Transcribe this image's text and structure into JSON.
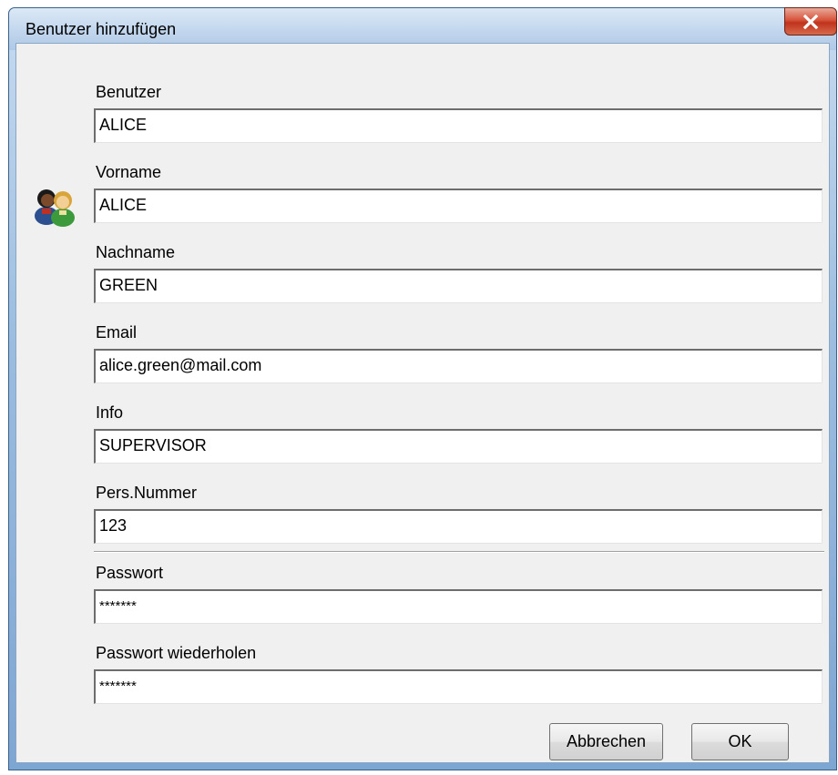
{
  "window": {
    "title": "Benutzer hinzufügen",
    "close_glyph": "X"
  },
  "fields": [
    {
      "label": "Benutzer",
      "value": "ALICE"
    },
    {
      "label": "Vorname",
      "value": "ALICE"
    },
    {
      "label": "Nachname",
      "value": "GREEN"
    },
    {
      "label": "Email",
      "value": "alice.green@mail.com"
    },
    {
      "label": "Info",
      "value": "SUPERVISOR"
    },
    {
      "label": "Pers.Nummer",
      "value": "123"
    },
    {
      "label": "Passwort",
      "value": "*******"
    },
    {
      "label": "Passwort wiederholen",
      "value": "*******"
    }
  ],
  "buttons": {
    "cancel": "Abbrechen",
    "ok": "OK"
  },
  "icons": {
    "users": "users-icon",
    "close": "close-icon"
  },
  "colors": {
    "title_gradient_top": "#dce9f6",
    "close_red": "#c0321c",
    "client_bg": "#f0f0f0"
  }
}
